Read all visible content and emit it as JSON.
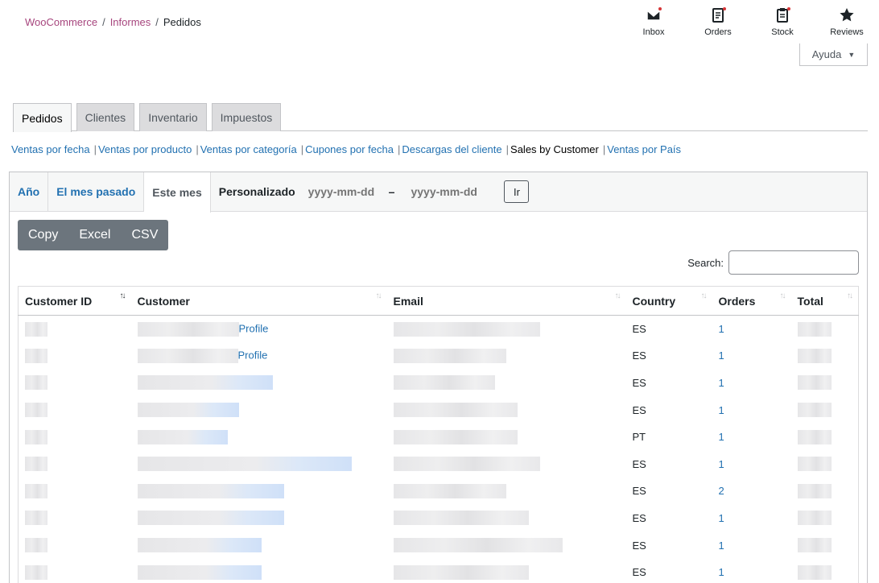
{
  "breadcrumb": {
    "root": "WooCommerce",
    "parent": "Informes",
    "current": "Pedidos"
  },
  "activity": [
    {
      "label": "Inbox",
      "icon": "inbox-icon"
    },
    {
      "label": "Orders",
      "icon": "orders-icon"
    },
    {
      "label": "Stock",
      "icon": "stock-icon"
    },
    {
      "label": "Reviews",
      "icon": "star-icon"
    }
  ],
  "help": {
    "label": "Ayuda"
  },
  "tabs": [
    "Pedidos",
    "Clientes",
    "Inventario",
    "Impuestos"
  ],
  "sublinks": [
    "Ventas por fecha",
    "Ventas por producto",
    "Ventas por categoría",
    "Cupones por fecha",
    "Descargas del cliente",
    "Sales by Customer",
    "Ventas por País"
  ],
  "ranges": {
    "year": "Año",
    "last_month": "El mes pasado",
    "this_month": "Este mes",
    "custom": "Personalizado"
  },
  "date_placeholder": "yyyy-mm-dd",
  "go_label": "Ir",
  "export": {
    "copy": "Copy",
    "excel": "Excel",
    "csv": "CSV"
  },
  "search_label": "Search:",
  "columns": [
    "Customer ID",
    "Customer",
    "Email",
    "Country",
    "Orders",
    "Total"
  ],
  "profile_label": "Profile",
  "rows": [
    {
      "country": "ES",
      "orders": "1"
    },
    {
      "country": "ES",
      "orders": "1"
    },
    {
      "country": "ES",
      "orders": "1"
    },
    {
      "country": "ES",
      "orders": "1"
    },
    {
      "country": "PT",
      "orders": "1"
    },
    {
      "country": "ES",
      "orders": "1"
    },
    {
      "country": "ES",
      "orders": "2"
    },
    {
      "country": "ES",
      "orders": "1"
    },
    {
      "country": "ES",
      "orders": "1"
    },
    {
      "country": "ES",
      "orders": "1"
    }
  ],
  "colors": {
    "brand": "#a7467e",
    "link": "#2271b1",
    "export_bg": "#6c757d"
  }
}
